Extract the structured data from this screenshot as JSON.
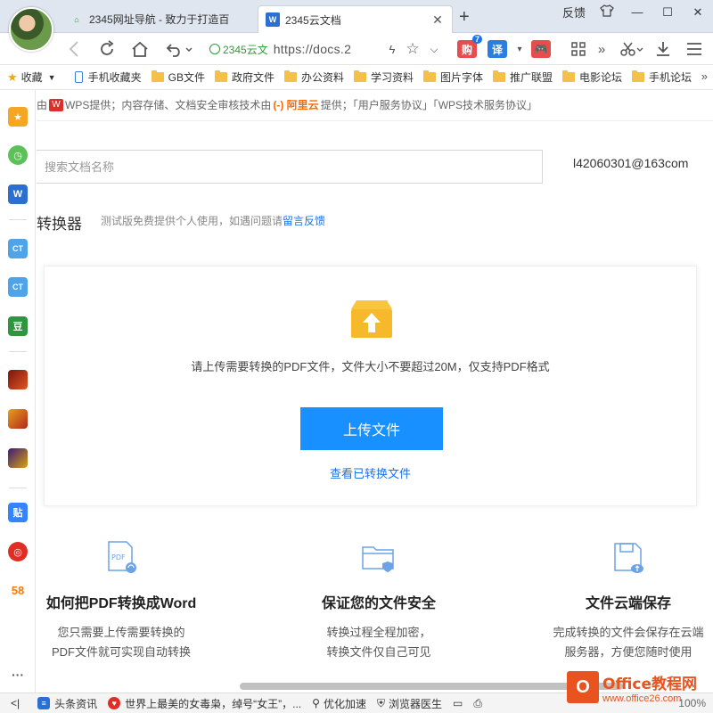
{
  "browser": {
    "tabs": [
      {
        "title": "2345网址导航 - 致力于打造百",
        "icon": "2345-icon"
      },
      {
        "title": "2345云文档",
        "icon": "word-doc-icon",
        "close": "✕"
      }
    ],
    "new_tab": "+",
    "window_controls": {
      "feedback": "反馈",
      "shirt": "👕",
      "minimize": "—",
      "maximize": "☐",
      "close": "✕"
    },
    "address": {
      "secure_label": "2345云文",
      "url": "https://docs.2"
    },
    "extensions": [
      {
        "label": "购",
        "badge": "7",
        "color": "#e84d4d"
      },
      {
        "label": "译",
        "color": "#2a7de1"
      },
      {
        "label": "🎮",
        "color": "#e84d4d"
      }
    ]
  },
  "bookmarks": {
    "collect_label": "收藏",
    "items": [
      {
        "label": "手机收藏夹",
        "kind": "phone"
      },
      {
        "label": "GB文件",
        "kind": "folder"
      },
      {
        "label": "政府文件",
        "kind": "folder"
      },
      {
        "label": "办公资料",
        "kind": "folder"
      },
      {
        "label": "学习资料",
        "kind": "folder"
      },
      {
        "label": "图片字体",
        "kind": "folder"
      },
      {
        "label": "推广联盟",
        "kind": "folder"
      },
      {
        "label": "电影论坛",
        "kind": "folder"
      },
      {
        "label": "手机论坛",
        "kind": "folder"
      }
    ],
    "more": "»"
  },
  "sidebar": {
    "items": [
      {
        "name": "favorites-star-icon",
        "label": "★",
        "color": "#f5a623"
      },
      {
        "name": "history-clock-icon",
        "label": "◷",
        "color": "#5cc159"
      },
      {
        "name": "word-doc-icon",
        "label": "W",
        "color": "#2b6fd1"
      },
      {
        "name": "ct-app-icon",
        "label": "CT",
        "color": "#4fa3e8"
      },
      {
        "name": "ct-app-2-icon",
        "label": "CT",
        "color": "#4fa3e8"
      },
      {
        "name": "douban-icon",
        "label": "豆",
        "color": "#2e963d"
      },
      {
        "name": "game-1-icon",
        "label": "",
        "color": "#b3261e"
      },
      {
        "name": "game-2-icon",
        "label": "",
        "color": "#d9730d"
      },
      {
        "name": "game-3-icon",
        "label": "",
        "color": "#6b2fa0"
      },
      {
        "name": "tieba-icon",
        "label": "贴",
        "color": "#3385ff"
      },
      {
        "name": "netease-music-icon",
        "label": "◎",
        "color": "#e02e24"
      },
      {
        "name": "58-icon",
        "label": "58",
        "color": "#ff7a00"
      }
    ],
    "more": "···"
  },
  "notice": {
    "prefix": "由",
    "wps": "W",
    "text1": "WPS提供；内容存储、文档安全审核技术由",
    "aliyun": "(-) 阿里云",
    "text2": "提供；「用户服务协议」「WPS技术服务协议」"
  },
  "search": {
    "placeholder": "搜索文档名称"
  },
  "user": {
    "email": "l42060301@163com"
  },
  "converter": {
    "title": "转换器",
    "subtitle": "测试版免费提供个人使用，如遇问题请",
    "feedback_link": "留言反馈",
    "upload_desc": "请上传需要转换的PDF文件，文件大小不要超过20M，仅支持PDF格式",
    "upload_button": "上传文件",
    "view_converted": "查看已转换文件"
  },
  "features": [
    {
      "icon": "pdf-file-icon",
      "title": "如何把PDF转换成Word",
      "line1": "您只需要上传需要转换的",
      "line2": "PDF文件就可实现自动转换"
    },
    {
      "icon": "secure-folder-icon",
      "title": "保证您的文件安全",
      "line1": "转换过程全程加密，",
      "line2": "转换文件仅自己可见"
    },
    {
      "icon": "cloud-save-icon",
      "title": "文件云端保存",
      "line1": "完成转换的文件会保存在云端",
      "line2": "服务器，方便您随时使用"
    }
  ],
  "statusbar": {
    "collapse": "<|",
    "news": "头条资讯",
    "headline": "世界上最美的女毒枭，绰号“女王”，...",
    "optimize": "优化加速",
    "doctor": "浏览器医生",
    "zoom": "100%"
  },
  "watermark": {
    "logo": "O",
    "site": "Office教程网",
    "url": "www.office26.com"
  }
}
